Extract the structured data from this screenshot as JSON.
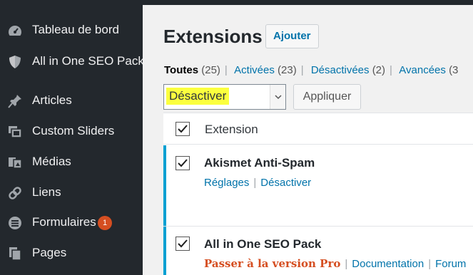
{
  "sidebar": {
    "items": [
      {
        "label": "Tableau de bord",
        "icon": "dashboard-icon"
      },
      {
        "label": "All in One SEO Pack",
        "icon": "shield-icon"
      },
      {
        "label": "Articles",
        "icon": "pushpin-icon"
      },
      {
        "label": "Custom Sliders",
        "icon": "slides-icon"
      },
      {
        "label": "Médias",
        "icon": "media-icon"
      },
      {
        "label": "Liens",
        "icon": "link-icon"
      },
      {
        "label": "Formulaires",
        "icon": "forms-icon",
        "badge": "1"
      },
      {
        "label": "Pages",
        "icon": "pages-icon"
      }
    ]
  },
  "header": {
    "title": "Extensions",
    "add_button": "Ajouter"
  },
  "filters": {
    "all_label": "Toutes",
    "all_count": "(25)",
    "active_label": "Activées",
    "active_count": "(23)",
    "inactive_label": "Désactivées",
    "inactive_count": "(2)",
    "advanced_label": "Avancées",
    "advanced_count": "(3"
  },
  "bulk_actions": {
    "selected": "Désactiver",
    "highlight_color": "#fbff3e",
    "apply_label": "Appliquer"
  },
  "table": {
    "column_header": "Extension",
    "rows": [
      {
        "name": "Akismet Anti-Spam",
        "checked": true,
        "actions": [
          "Réglages",
          "Désactiver"
        ]
      },
      {
        "name": "All in One SEO Pack",
        "checked": true,
        "actions": [
          "Passer à la version Pro",
          "Documentation",
          "Forum"
        ]
      }
    ]
  },
  "colors": {
    "sidebar_bg": "#23282d",
    "link": "#0073aa",
    "active_border": "#00a0d2",
    "badge": "#d54e21",
    "pro_link": "#d54e21"
  }
}
